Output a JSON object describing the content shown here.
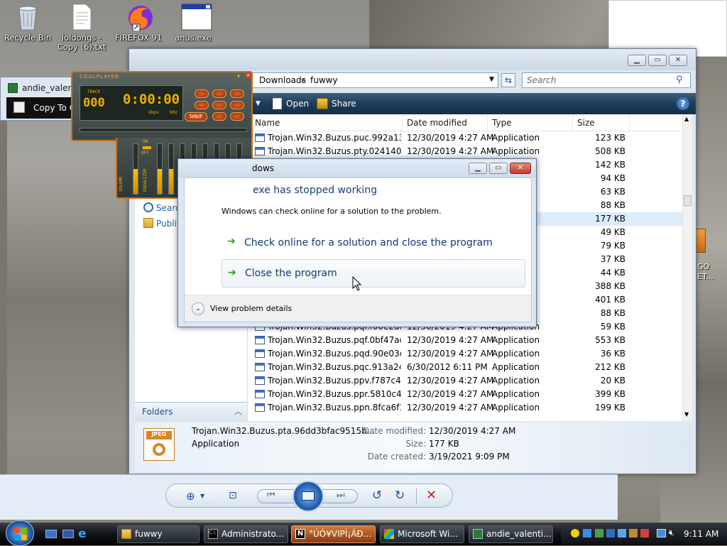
{
  "desktop": {
    "icons": [
      {
        "label": "Recycle Bin",
        "icon": "recycle-bin-icon"
      },
      {
        "label": "loldongs - Copy (6).txt",
        "icon": "text-file-icon"
      },
      {
        "label": "FIREFOX 91",
        "icon": "firefox-icon"
      },
      {
        "label": "anus.exe",
        "icon": "exe-window-icon"
      }
    ],
    "partial_label_1": "andie_valenti",
    "partial_label_2": "Copy To G",
    "partial_right_1": "GO",
    "partial_right_2": "ET..."
  },
  "explorer": {
    "breadcrumb": [
      "Downloads",
      "fuwwy"
    ],
    "search_placeholder": "Search",
    "toolbar": {
      "open": "Open",
      "share": "Share"
    },
    "left_items": [
      "Search",
      "Publi"
    ],
    "folders_label": "Folders",
    "columns": [
      "Name",
      "Date modified",
      "Type",
      "Size"
    ],
    "rows": [
      {
        "name": "Trojan.Win32.Buzus.puc.992a135c...",
        "date": "12/30/2019 4:27 AM",
        "type": "Application",
        "size": "123 KB"
      },
      {
        "name": "Trojan.Win32.Buzus.pty.02414065...",
        "date": "12/30/2019 4:27 AM",
        "type": "Application",
        "size": "508 KB"
      },
      {
        "name": "",
        "date": "",
        "type": "",
        "size": "142 KB"
      },
      {
        "name": "",
        "date": "",
        "type": "",
        "size": "94 KB"
      },
      {
        "name": "",
        "date": "",
        "type": "",
        "size": "63 KB"
      },
      {
        "name": "",
        "date": "",
        "type": "",
        "size": "88 KB"
      },
      {
        "name": "",
        "date": "",
        "type": "",
        "size": "177 KB"
      },
      {
        "name": "",
        "date": "",
        "type": "",
        "size": "49 KB"
      },
      {
        "name": "",
        "date": "",
        "type": "",
        "size": "79 KB"
      },
      {
        "name": "",
        "date": "",
        "type": "",
        "size": "37 KB"
      },
      {
        "name": "",
        "date": "",
        "type": "",
        "size": "44 KB"
      },
      {
        "name": "",
        "date": "",
        "type": "",
        "size": "388 KB"
      },
      {
        "name": "",
        "date": "",
        "type": "",
        "size": "401 KB"
      },
      {
        "name": "",
        "date": "",
        "type": "",
        "size": "88 KB"
      },
      {
        "name": "Trojan.Win32.Buzus.pqi.f00e2acc...",
        "date": "12/30/2019 4:27 AM",
        "type": "Application",
        "size": "59 KB"
      },
      {
        "name": "Trojan.Win32.Buzus.pqf.0bf47ac9...",
        "date": "12/30/2019 4:27 AM",
        "type": "Application",
        "size": "553 KB"
      },
      {
        "name": "Trojan.Win32.Buzus.pqd.90e03cb...",
        "date": "12/30/2019 4:27 AM",
        "type": "Application",
        "size": "36 KB"
      },
      {
        "name": "Trojan.Win32.Buzus.pqc.913a244f...",
        "date": "6/30/2012 6:11 PM",
        "type": "Application",
        "size": "212 KB"
      },
      {
        "name": "Trojan.Win32.Buzus.ppv.f787c480...",
        "date": "12/30/2019 4:27 AM",
        "type": "Application",
        "size": "20 KB"
      },
      {
        "name": "Trojan.Win32.Buzus.ppr.5810c4e9...",
        "date": "12/30/2019 4:27 AM",
        "type": "Application",
        "size": "399 KB"
      },
      {
        "name": "Trojan.Win32.Buzus.ppn.8fca6f1c...",
        "date": "12/30/2019 4:27 AM",
        "type": "Application",
        "size": "199 KB"
      }
    ],
    "details": {
      "filename": "Trojan.Win32.Buzus.pta.96dd3bfac9515b...",
      "type": "Application",
      "date_modified_label": "Date modified:",
      "date_modified": "12/30/2019 4:27 AM",
      "size_label": "Size:",
      "size": "177 KB",
      "date_created_label": "Date created:",
      "date_created": "3/19/2021 9:09 PM"
    }
  },
  "coolplayer": {
    "title": "COOLPLAYER",
    "track_label": "TRACK",
    "track": "000",
    "time": "0:00:00",
    "kbps": "kbps",
    "khz": "kHz",
    "shuf": "SHUF",
    "on": "ON",
    "off": "OFF",
    "volume": "VOLUME",
    "equalizer": "EQUALIZER",
    "volume_level": 0.5,
    "eq_levels": [
      0.45,
      0.5,
      0.5,
      0.5,
      0.5,
      0.5,
      0.5,
      0.5,
      0.5,
      0.5
    ]
  },
  "error_dialog": {
    "title": "dows",
    "heading": "exe has stopped working",
    "message": "Windows can check online for a solution to the problem.",
    "option1": "Check online for a solution and close the program",
    "option2": "Close the program",
    "details": "View problem details"
  },
  "taskbar": {
    "items": [
      {
        "label": "fuwwy",
        "icon": "folder-icon"
      },
      {
        "label": "Administrato...",
        "icon": "cmd-icon"
      },
      {
        "label": "°ÚÓ¥VIPÌ¡ÁÐ...",
        "icon": "app-n-icon"
      },
      {
        "label": "Microsoft Wi...",
        "icon": "microsoft-icon"
      },
      {
        "label": "andie_valenti...",
        "icon": "spreadsheet-icon"
      }
    ],
    "clock": "9:11 AM"
  }
}
